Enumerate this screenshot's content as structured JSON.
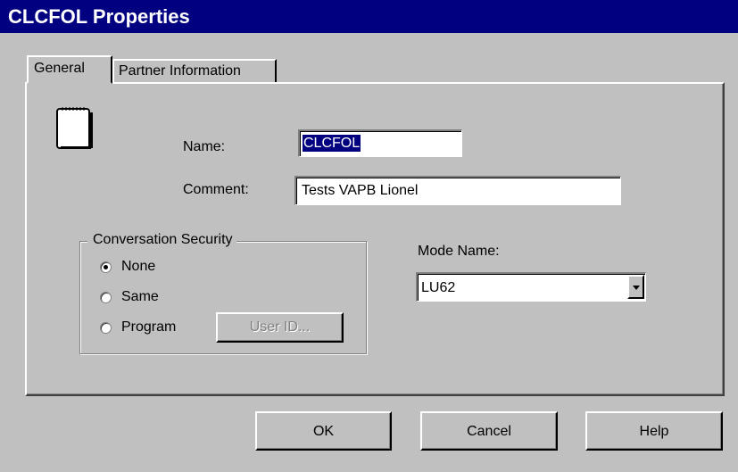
{
  "window": {
    "title": "CLCFOL Properties"
  },
  "tabs": [
    {
      "label": "General",
      "active": true
    },
    {
      "label": "Partner Information",
      "active": false
    }
  ],
  "icons": {
    "document": "document-icon",
    "dropdown": "chevron-down-icon"
  },
  "form": {
    "name": {
      "label": "Name:",
      "value": "CLCFOL"
    },
    "comment": {
      "label": "Comment:",
      "value": "Tests VAPB Lionel"
    },
    "mode": {
      "label": "Mode Name:",
      "value": "LU62"
    }
  },
  "security": {
    "title": "Conversation Security",
    "options": [
      {
        "label": "None",
        "selected": true
      },
      {
        "label": "Same",
        "selected": false
      },
      {
        "label": "Program",
        "selected": false
      }
    ],
    "userid_label": "User ID..."
  },
  "buttons": {
    "ok": "OK",
    "cancel": "Cancel",
    "help": "Help"
  },
  "colors": {
    "titlebar": "#000080",
    "face": "#c0c0c0",
    "selection": "#000080"
  }
}
